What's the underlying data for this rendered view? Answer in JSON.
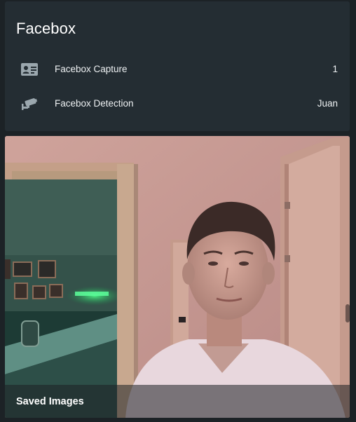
{
  "entities_card": {
    "title": "Facebox",
    "rows": [
      {
        "icon": "account-card-details-icon",
        "name": "Facebox Capture",
        "state": "1"
      },
      {
        "icon": "cctv-camera-icon",
        "name": "Facebox Detection",
        "state": "Juan"
      }
    ]
  },
  "picture_card": {
    "image": "camera-snapshot-person-in-hallway",
    "footer_title": "Saved Images"
  },
  "colors": {
    "page_background": "#1c2226",
    "card_background": "#242d33",
    "icon": "#9ba7ae",
    "text": "#eef1f3"
  }
}
